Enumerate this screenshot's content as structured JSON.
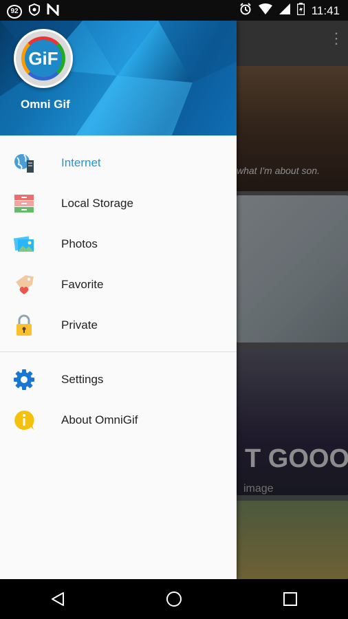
{
  "status_bar": {
    "badge": "92",
    "time": "11:41"
  },
  "app": {
    "name": "Omni Gif",
    "logo_text": "GiF"
  },
  "menu": {
    "items": [
      {
        "label": "Internet",
        "icon": "globe-server-icon",
        "active": true
      },
      {
        "label": "Local Storage",
        "icon": "drawer-cabinet-icon",
        "active": false
      },
      {
        "label": "Photos",
        "icon": "photos-icon",
        "active": false
      },
      {
        "label": "Favorite",
        "icon": "tag-heart-icon",
        "active": false
      },
      {
        "label": "Private",
        "icon": "padlock-icon",
        "active": false
      }
    ],
    "secondary": [
      {
        "label": "Settings",
        "icon": "gear-icon"
      },
      {
        "label": "About OmniGif",
        "icon": "info-bubble-icon"
      }
    ]
  },
  "background": {
    "caption1": "what I'm about son.",
    "caption3_big": "T GOOOOO",
    "caption3_small": "image"
  },
  "colors": {
    "accent": "#2196d3",
    "gear": "#1976d2",
    "info": "#f4c20d"
  }
}
